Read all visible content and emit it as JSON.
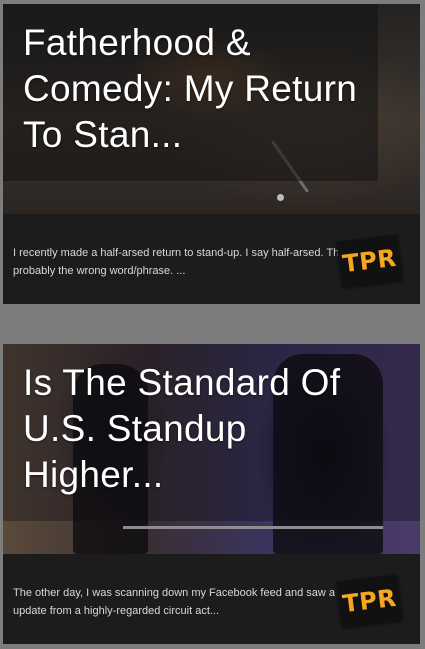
{
  "posts": [
    {
      "title": "Fatherhood & Comedy: My Return To Stan...",
      "excerpt": "I recently made a half-arsed return to stand-up. I say half-arsed. That's probably the wrong word/phrase. ...",
      "badge": "TPR"
    },
    {
      "title": "Is The Standard Of U.S. Standup Higher...",
      "excerpt": "The other day, I was scanning down my Facebook feed and saw a status update from a highly-regarded circuit act...",
      "badge": "TPR"
    }
  ],
  "colors": {
    "page_background": "#7d7d7d",
    "card_background": "#1c1c1c",
    "badge_text": "#f5a623"
  }
}
